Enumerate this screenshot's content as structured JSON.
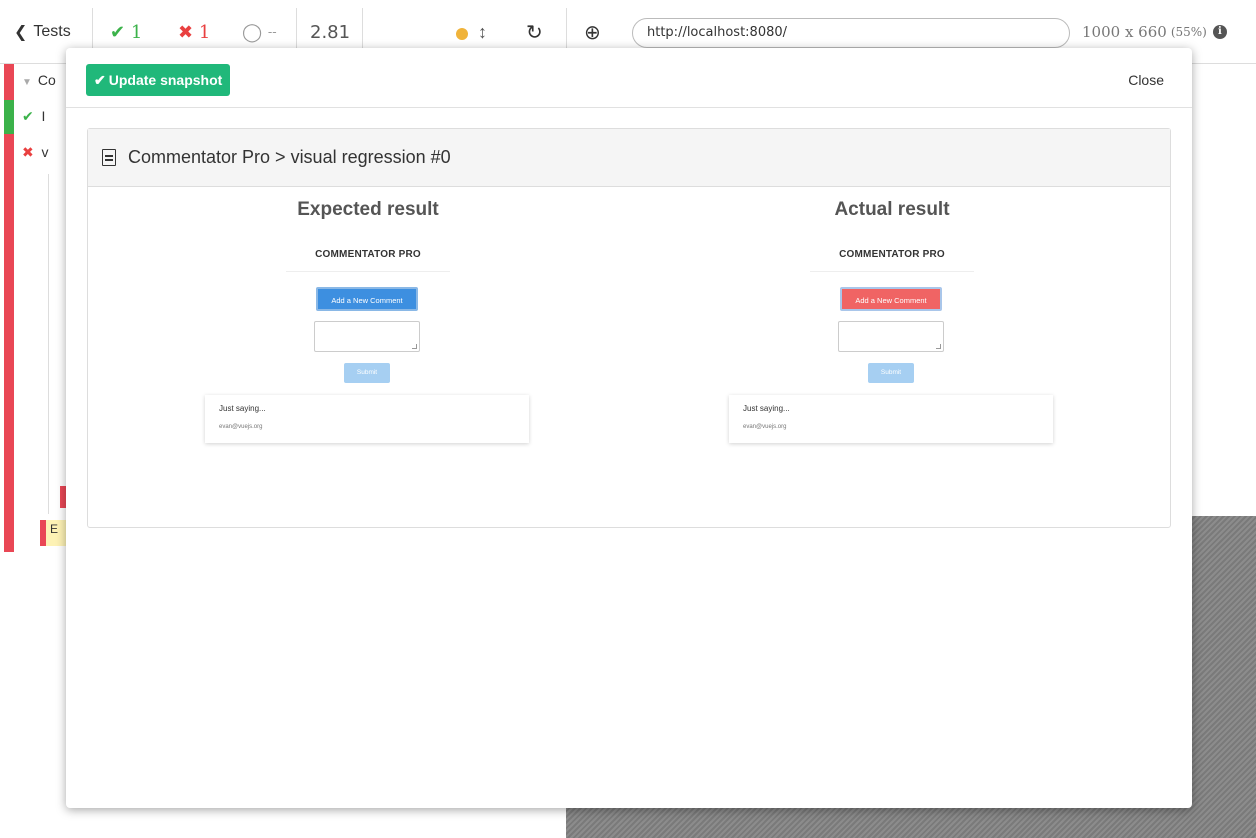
{
  "topbar": {
    "tests_label": "Tests",
    "passed": "1",
    "failed": "1",
    "pending": "--",
    "duration": "2.81",
    "url": "http://localhost:8080/",
    "viewport_size": "1000 x 660",
    "viewport_scale": "(55%)",
    "colors": {
      "pass": "#3bb24a",
      "fail": "#e94040",
      "running": "#f0b33a"
    }
  },
  "reporter": {
    "suite_label": "Co",
    "pass_item": "I",
    "fail_item": "v",
    "error_item": "E"
  },
  "modal": {
    "update_button_label": "Update snapshot",
    "close_label": "Close",
    "panel_title": "Commentator Pro > visual regression #0",
    "expected": {
      "title": "Expected result",
      "brand": "COMMENTATOR PRO",
      "button_label": "Add a New Comment",
      "button_color": "#3d8fe0",
      "submit_label": "Submit",
      "comment_text": "Just saying...",
      "comment_email": "evan@vuejs.org"
    },
    "actual": {
      "title": "Actual result",
      "brand": "COMMENTATOR PRO",
      "button_label": "Add a New Comment",
      "button_color": "#f06464",
      "submit_label": "Submit",
      "comment_text": "Just saying...",
      "comment_email": "evan@vuejs.org"
    },
    "accent_color": "#20b87a"
  }
}
